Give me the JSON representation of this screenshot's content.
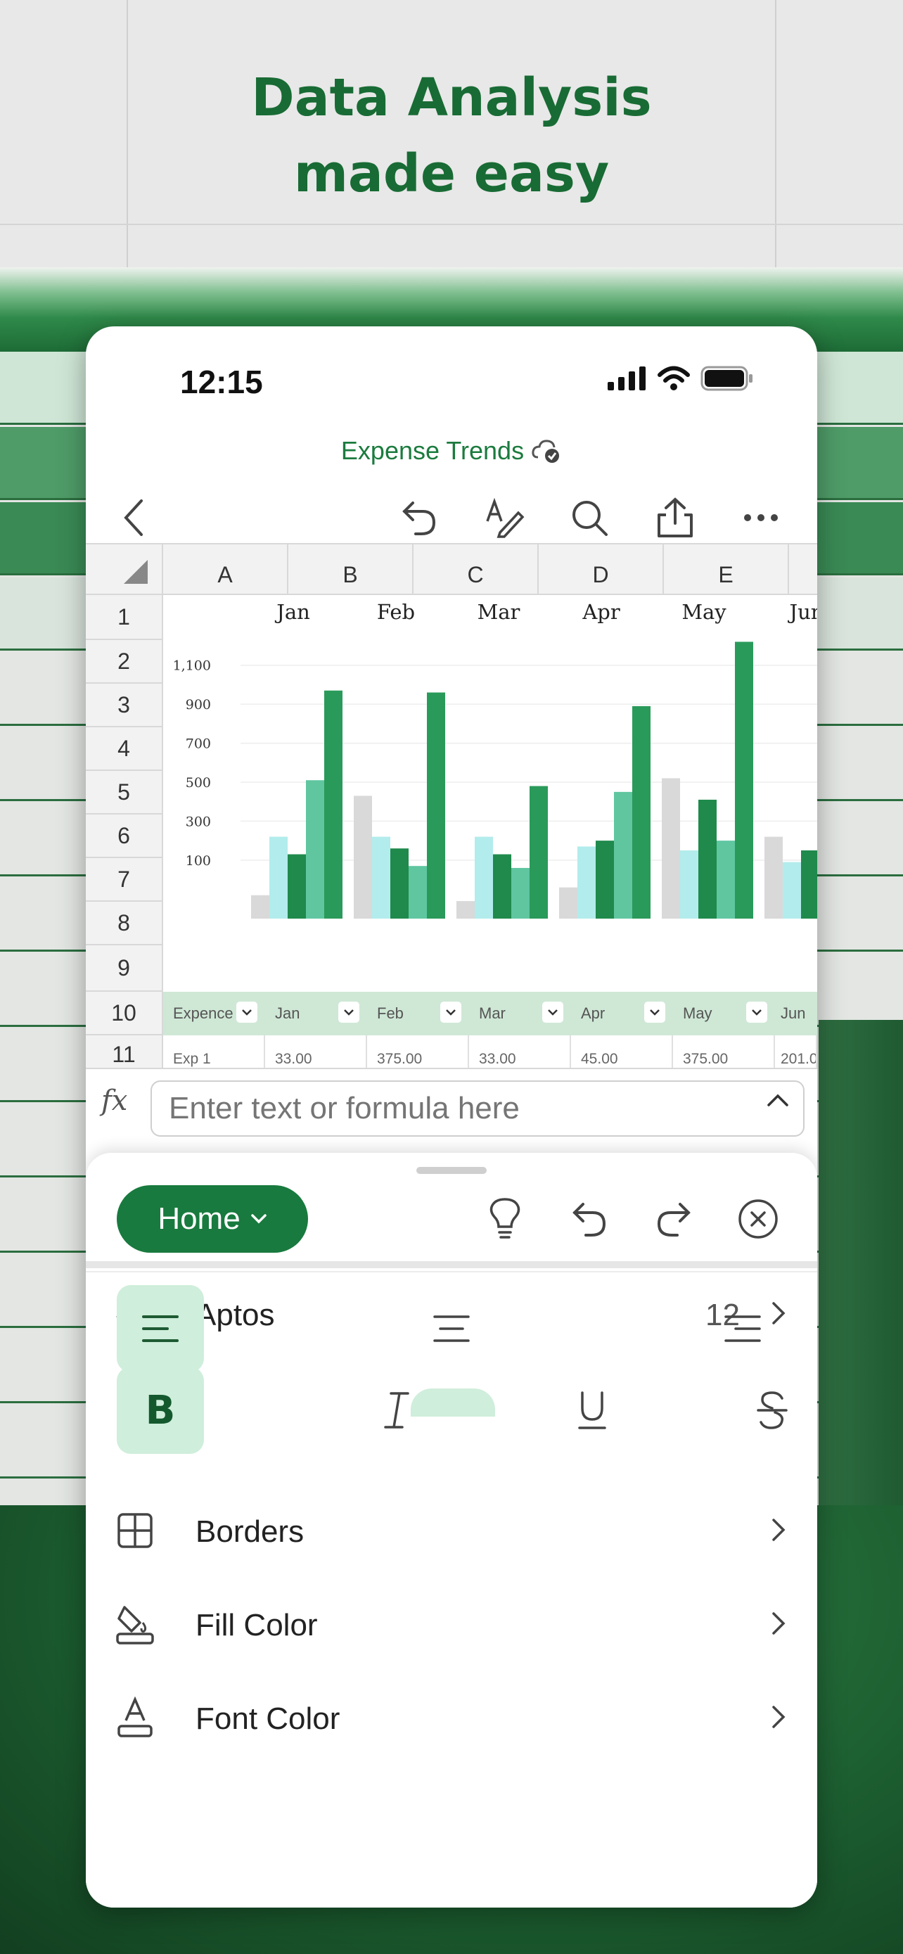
{
  "promo": {
    "headline_line1": "Data Analysis",
    "headline_line2": "made easy"
  },
  "status_bar": {
    "time": "12:15"
  },
  "document": {
    "title": "Expense Trends"
  },
  "sheet": {
    "columns": [
      "A",
      "B",
      "C",
      "D",
      "E"
    ],
    "rows": [
      "1",
      "2",
      "3",
      "4",
      "5",
      "6",
      "7",
      "8",
      "9",
      "10",
      "11"
    ],
    "table_headers": [
      "Expence",
      "Jan",
      "Feb",
      "Mar",
      "Apr",
      "May",
      "Jun"
    ],
    "first_row": [
      "Exp 1",
      "33.00",
      "375.00",
      "33.00",
      "45.00",
      "375.00",
      "201.0"
    ]
  },
  "chart_data": {
    "type": "bar",
    "categories": [
      "Jan",
      "Feb",
      "Mar",
      "Apr",
      "May",
      "Jun"
    ],
    "y_ticks": [
      "100",
      "300",
      "500",
      "700",
      "900",
      "1,100"
    ],
    "ylim": [
      -200,
      1200
    ],
    "series": [
      {
        "values": [
          -80,
          430,
          -110,
          -40,
          520,
          220
        ],
        "color": "#d9d9d9"
      },
      {
        "values": [
          220,
          220,
          220,
          170,
          150,
          90
        ],
        "color": "#b3ecec"
      },
      {
        "values": [
          130,
          160,
          130,
          200,
          410,
          150
        ],
        "color": "#1f8a4c"
      },
      {
        "values": [
          510,
          70,
          60,
          450,
          200,
          null
        ],
        "color": "#5fc6a0"
      },
      {
        "values": [
          970,
          960,
          480,
          890,
          1220,
          null
        ],
        "color": "#2a9a5a"
      }
    ]
  },
  "formula_bar": {
    "fx": "fx",
    "placeholder": "Enter text or formula here"
  },
  "ribbon": {
    "tab": "Home",
    "font_name": "Aptos",
    "font_size": "12",
    "bold": "B",
    "borders": "Borders",
    "fill_color": "Fill Color",
    "font_color": "Font Color"
  },
  "colors": {
    "accent": "#187a3e",
    "accent_light": "#cfeedb",
    "title_green": "#1b7b3e"
  }
}
